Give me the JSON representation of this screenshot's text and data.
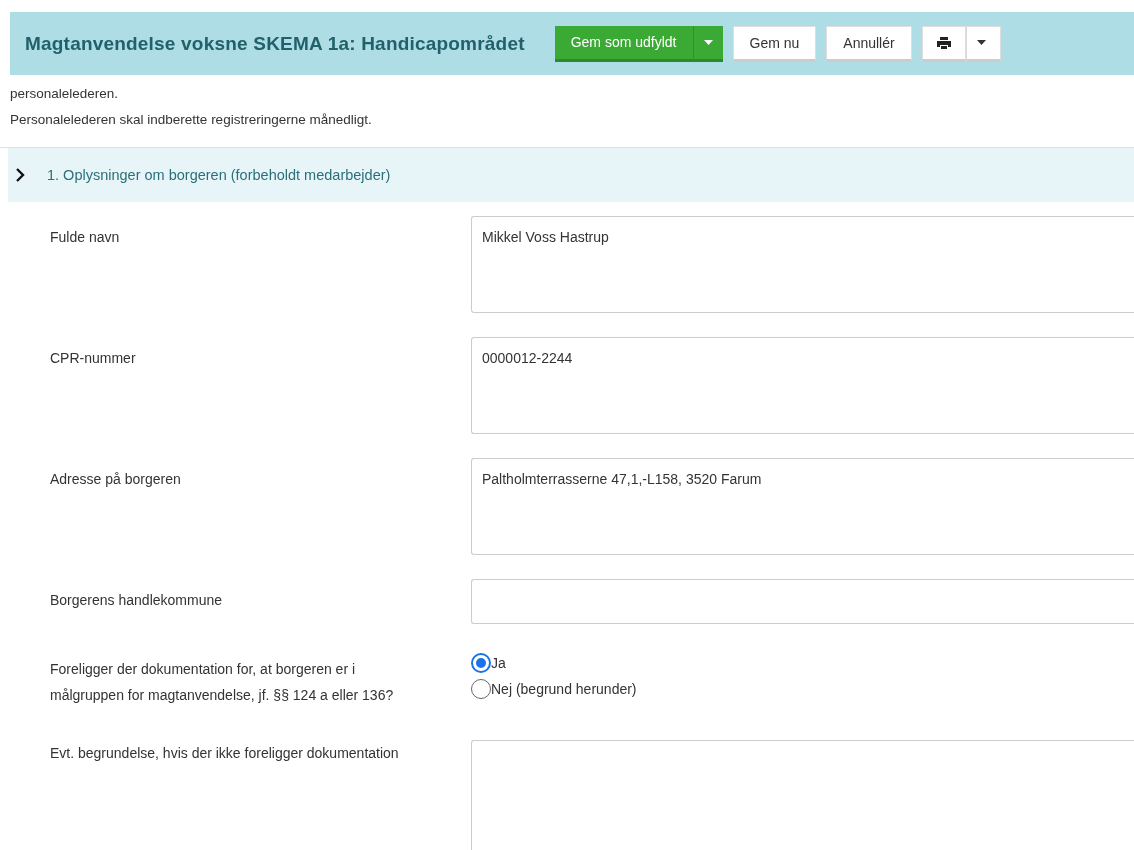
{
  "header": {
    "title": "Magtanvendelse voksne SKEMA 1a: Handicapområdet",
    "buttons": [
      {
        "kind": "primary-split",
        "label": "Gem som udfyldt"
      },
      {
        "kind": "plain",
        "label": "Gem nu"
      },
      {
        "kind": "plain",
        "label": "Annullér"
      },
      {
        "kind": "print-split"
      }
    ]
  },
  "intro": [
    "personalelederen.",
    "Personalelederen skal indberette registreringerne månedligt."
  ],
  "section": {
    "title": "1. Oplysninger om borgeren (forbeholdt medarbejder)",
    "expanded": false
  },
  "fields": [
    {
      "kind": "textarea",
      "label": "Fulde navn",
      "value": "Mikkel Voss Hastrup"
    },
    {
      "kind": "textarea",
      "label": "CPR-nummer",
      "value": "0000012-2244"
    },
    {
      "kind": "textarea",
      "label": "Adresse på borgeren",
      "value": "Paltholmterrasserne 47,1,-L158, 3520 Farum"
    },
    {
      "kind": "input",
      "label": "Borgerens handlekommune"
    },
    {
      "kind": "radio",
      "label": "Foreligger der dokumentation for, at borgeren er i målgruppen for magtanvendelse, jf. §§ 124 a eller 136?",
      "options": [
        {
          "label": "Ja",
          "selected": true
        },
        {
          "label": "Nej (begrund herunder)",
          "selected": false
        }
      ]
    },
    {
      "kind": "textarea",
      "label": "Evt. begrundelse, hvis der ikke foreligger dokumentation"
    }
  ]
}
